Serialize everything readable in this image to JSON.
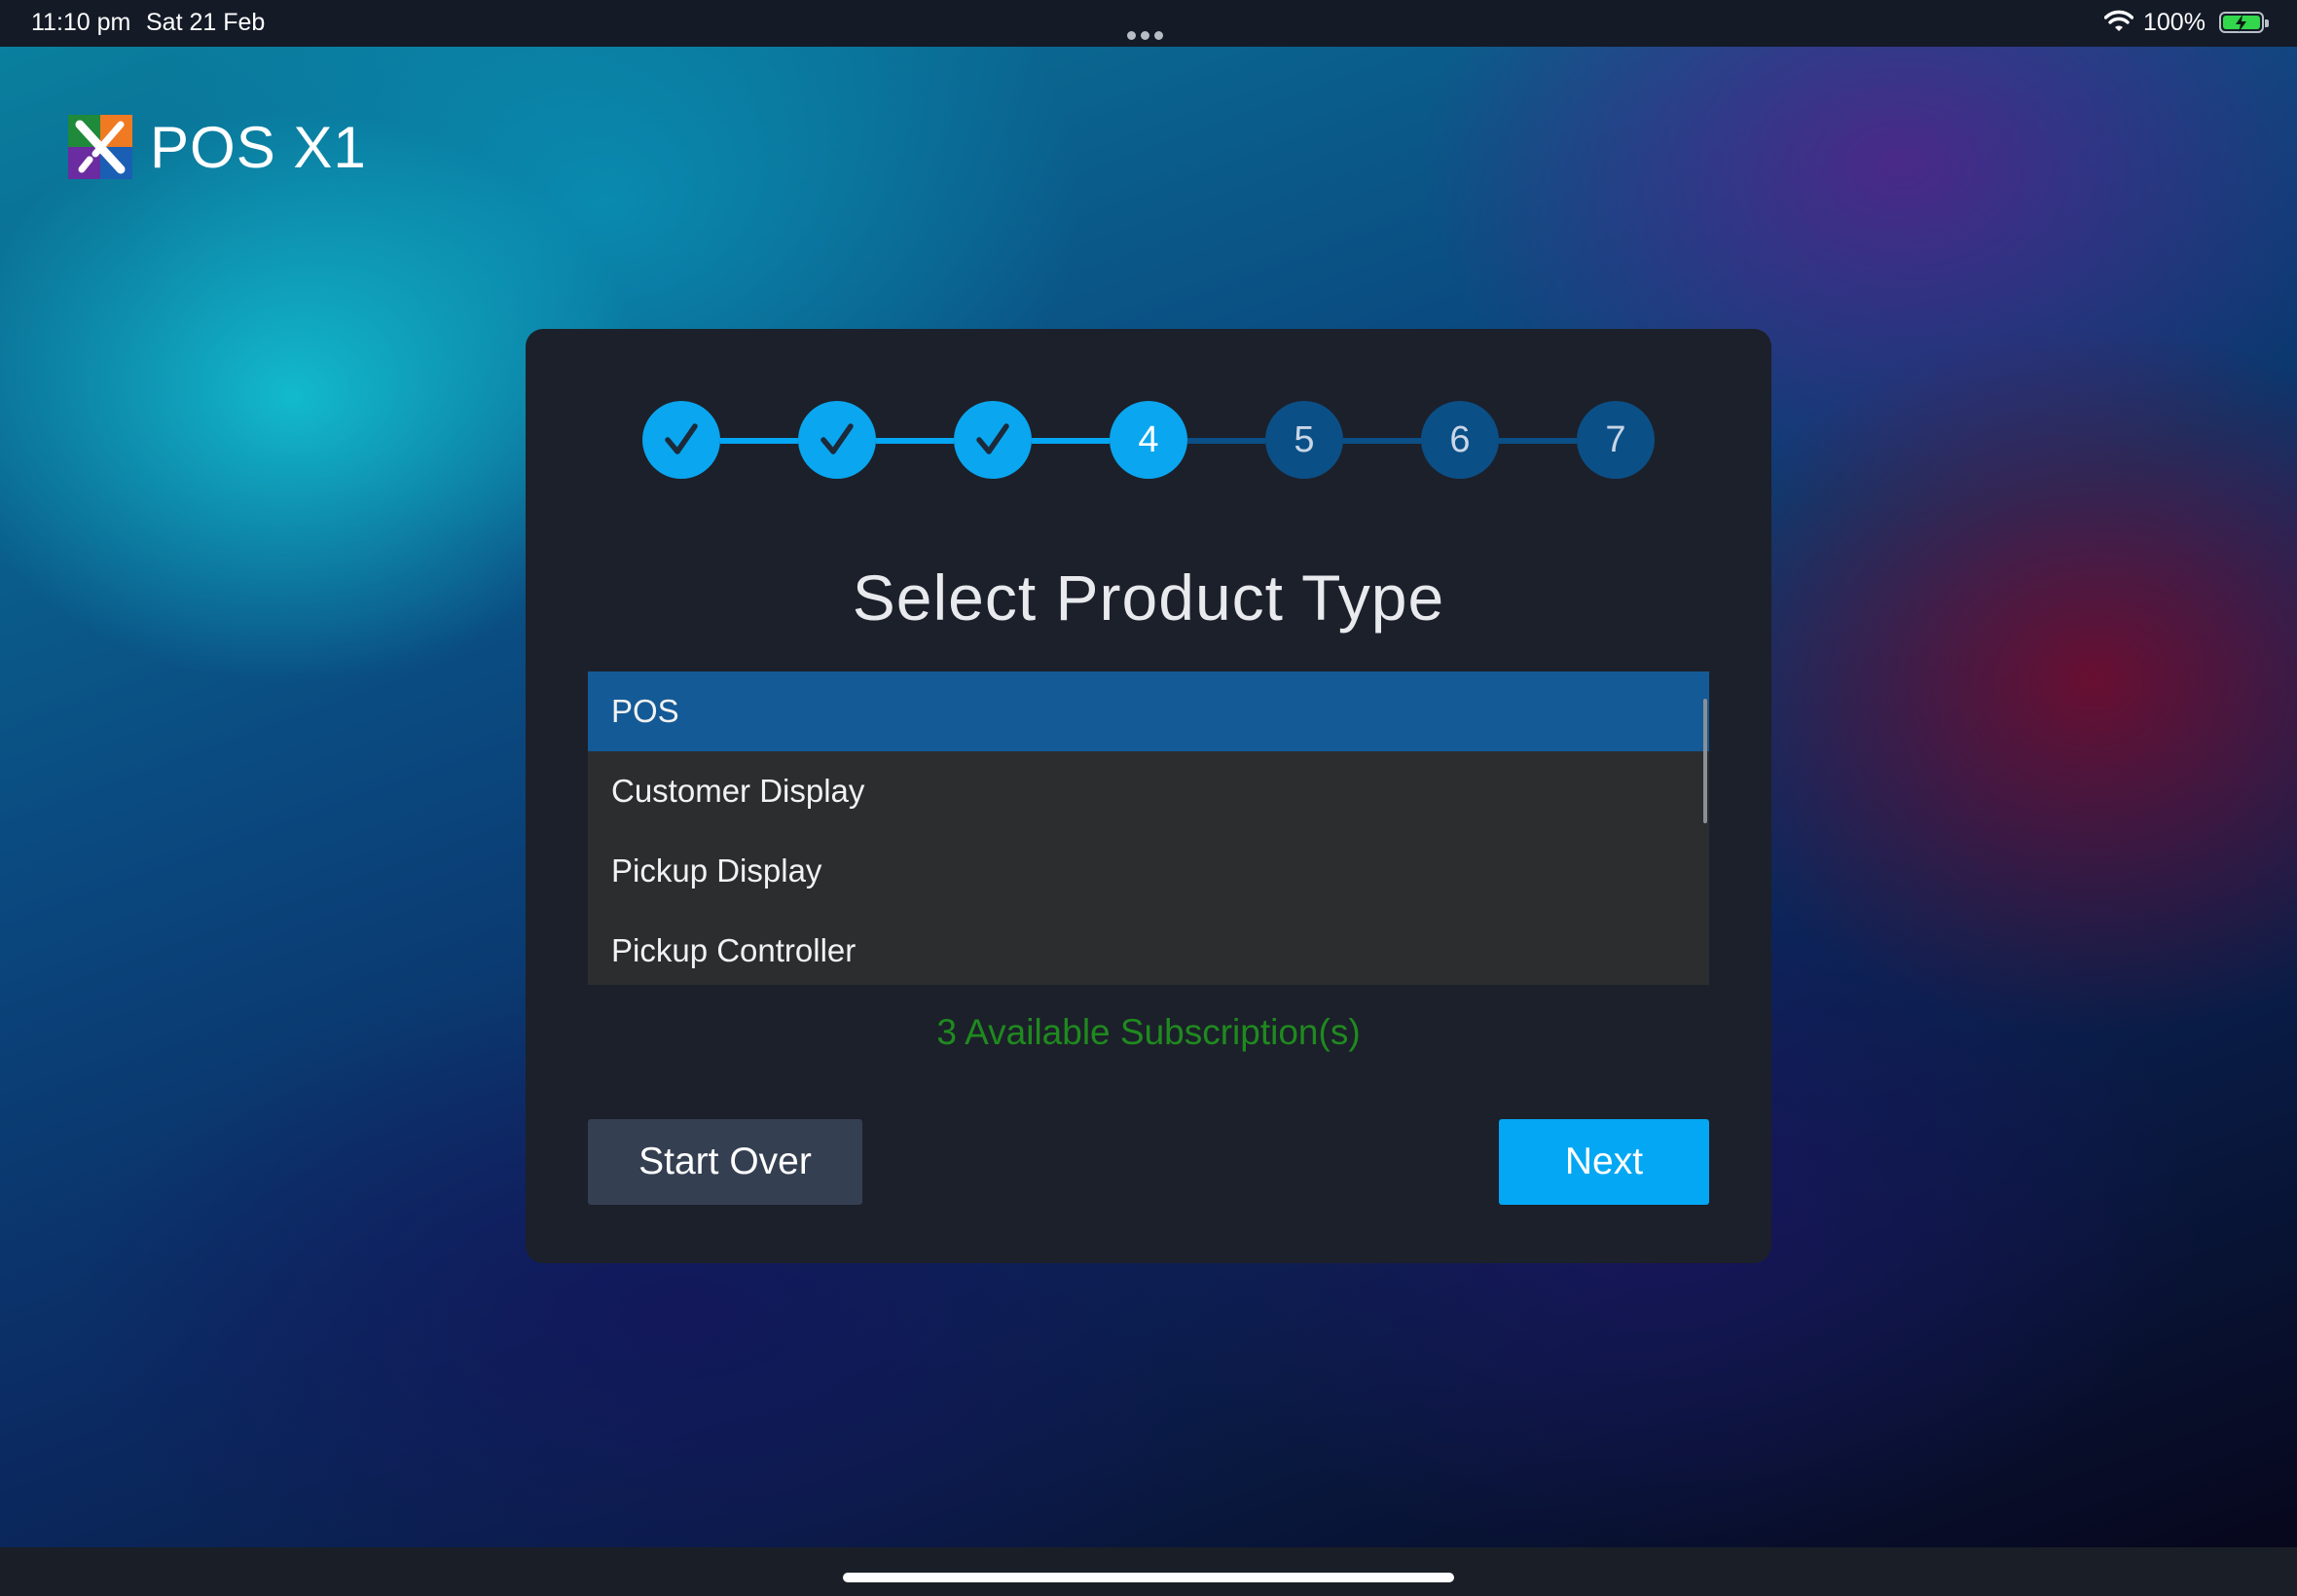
{
  "status_bar": {
    "time": "11:10 pm",
    "date": "Sat 21 Feb",
    "battery": "100%"
  },
  "brand": {
    "name": "POS X1"
  },
  "wizard": {
    "title": "Select Product Type",
    "steps": [
      {
        "label": "1",
        "state": "done"
      },
      {
        "label": "2",
        "state": "done"
      },
      {
        "label": "3",
        "state": "done"
      },
      {
        "label": "4",
        "state": "active"
      },
      {
        "label": "5",
        "state": "future"
      },
      {
        "label": "6",
        "state": "future"
      },
      {
        "label": "7",
        "state": "future"
      }
    ],
    "product_types": [
      {
        "label": "POS",
        "selected": true
      },
      {
        "label": "Customer Display",
        "selected": false
      },
      {
        "label": "Pickup Display",
        "selected": false
      },
      {
        "label": "Pickup Controller",
        "selected": false
      }
    ],
    "subscriptions_text": "3 Available Subscription(s)",
    "start_over_label": "Start Over",
    "next_label": "Next"
  },
  "colors": {
    "accent": "#04a7f3",
    "selected_row": "#145a96",
    "step_future": "#0b4f87",
    "subscriptions_text": "#1f8a1f",
    "card_bg": "#1c202a"
  }
}
